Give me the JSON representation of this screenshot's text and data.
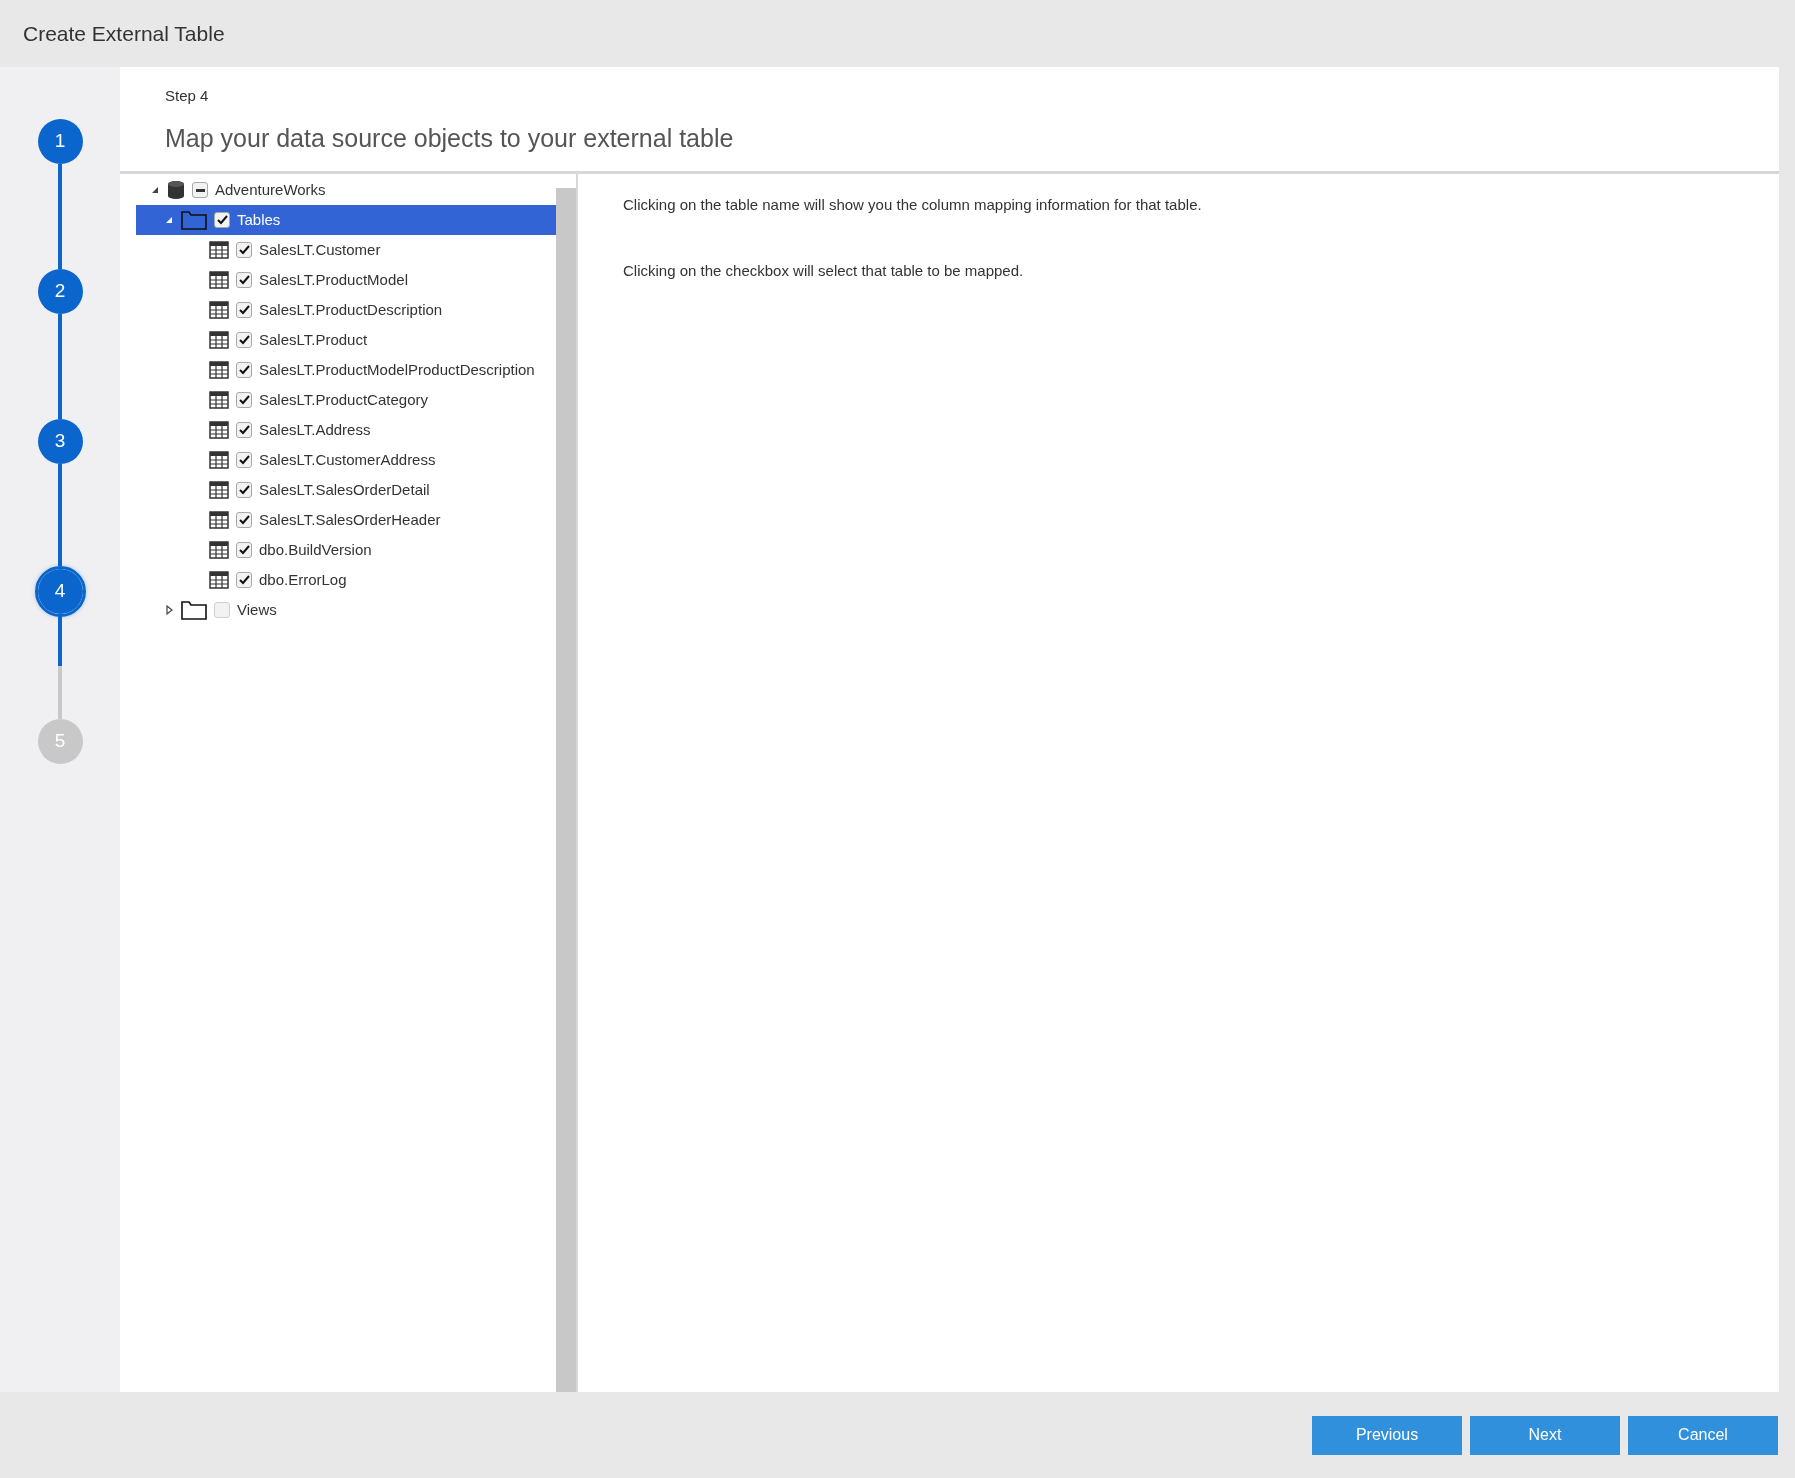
{
  "window": {
    "title": "Create External Table"
  },
  "steps": [
    {
      "number": "1",
      "done": true,
      "current": false
    },
    {
      "number": "2",
      "done": true,
      "current": false
    },
    {
      "number": "3",
      "done": true,
      "current": false
    },
    {
      "number": "4",
      "done": false,
      "current": true
    },
    {
      "number": "5",
      "done": false,
      "current": false
    }
  ],
  "header": {
    "step_label": "Step 4",
    "heading": "Map your data source objects to your external table"
  },
  "tree": [
    {
      "kind": "database",
      "label": "AdventureWorks",
      "expanded": true,
      "checked": true,
      "indeterminate": true,
      "selected": false,
      "children": [
        {
          "kind": "folder",
          "label": "Tables",
          "expanded": true,
          "checked": true,
          "indeterminate": false,
          "selected": true,
          "children": [
            {
              "kind": "table",
              "label": "SalesLT.Customer",
              "checked": true,
              "indeterminate": false,
              "selected": false
            },
            {
              "kind": "table",
              "label": "SalesLT.ProductModel",
              "checked": true,
              "indeterminate": false,
              "selected": false
            },
            {
              "kind": "table",
              "label": "SalesLT.ProductDescription",
              "checked": true,
              "indeterminate": false,
              "selected": false
            },
            {
              "kind": "table",
              "label": "SalesLT.Product",
              "checked": true,
              "indeterminate": false,
              "selected": false
            },
            {
              "kind": "table",
              "label": "SalesLT.ProductModelProductDescription",
              "checked": true,
              "indeterminate": false,
              "selected": false
            },
            {
              "kind": "table",
              "label": "SalesLT.ProductCategory",
              "checked": true,
              "indeterminate": false,
              "selected": false
            },
            {
              "kind": "table",
              "label": "SalesLT.Address",
              "checked": true,
              "indeterminate": false,
              "selected": false
            },
            {
              "kind": "table",
              "label": "SalesLT.CustomerAddress",
              "checked": true,
              "indeterminate": false,
              "selected": false
            },
            {
              "kind": "table",
              "label": "SalesLT.SalesOrderDetail",
              "checked": true,
              "indeterminate": false,
              "selected": false
            },
            {
              "kind": "table",
              "label": "SalesLT.SalesOrderHeader",
              "checked": true,
              "indeterminate": false,
              "selected": false
            },
            {
              "kind": "table",
              "label": "dbo.BuildVersion",
              "checked": true,
              "indeterminate": false,
              "selected": false
            },
            {
              "kind": "table",
              "label": "dbo.ErrorLog",
              "checked": true,
              "indeterminate": false,
              "selected": false
            }
          ]
        },
        {
          "kind": "folder",
          "label": "Views",
          "expanded": false,
          "checked": false,
          "indeterminate": false,
          "selected": false
        }
      ]
    }
  ],
  "info": [
    "Clicking on the table name will show you the column mapping information for that table.",
    "Clicking on the checkbox will select that table to be mapped."
  ],
  "buttons": [
    "Previous",
    "Next",
    "Cancel"
  ]
}
